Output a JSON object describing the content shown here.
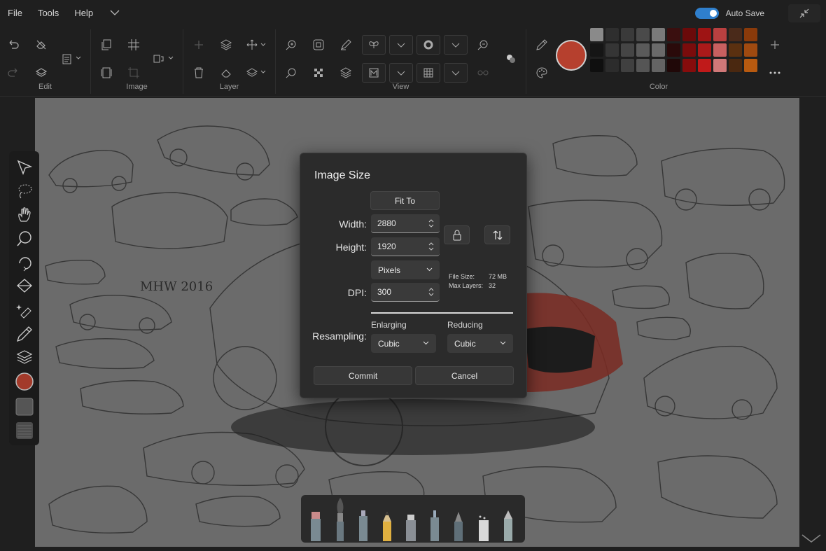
{
  "menu": {
    "items": [
      "File",
      "Tools",
      "Help"
    ]
  },
  "autosave": {
    "label": "Auto Save",
    "on": true
  },
  "ribbon": {
    "groups": {
      "edit": "Edit",
      "image": "Image",
      "layer": "Layer",
      "view": "View",
      "color": "Color"
    },
    "current_color": "#b6402e",
    "swatches": [
      "#8a8a8a",
      "#2e2e2e",
      "#3a3a3a",
      "#4a4a4a",
      "#7a7a7a",
      "#3a0f0f",
      "#6a0a0a",
      "#9e1414",
      "#b94040",
      "#4a2a1a",
      "#8a3a0a",
      "#151515",
      "#353535",
      "#454545",
      "#5a5a5a",
      "#6a6a6a",
      "#2a0a0a",
      "#7a0c0c",
      "#aa1a1a",
      "#c86060",
      "#5a3010",
      "#a04a10",
      "#0f0f0f",
      "#2c2c2c",
      "#404040",
      "#555555",
      "#646464",
      "#200808",
      "#860c0c",
      "#c01a1a",
      "#d07878",
      "#4a2810",
      "#b85a10"
    ]
  },
  "dialog": {
    "title": "Image Size",
    "fit_to": "Fit To",
    "width_label": "Width:",
    "width_value": "2880",
    "height_label": "Height:",
    "height_value": "1920",
    "units": "Pixels",
    "dpi_label": "DPI:",
    "dpi_value": "300",
    "file_size_label": "File Size:",
    "file_size_value": "72 MB",
    "max_layers_label": "Max Layers:",
    "max_layers_value": "32",
    "resampling_label": "Resampling:",
    "enlarging_label": "Enlarging",
    "enlarging_value": "Cubic",
    "reducing_label": "Reducing",
    "reducing_value": "Cubic",
    "commit": "Commit",
    "cancel": "Cancel"
  },
  "canvas": {
    "signature": "MHW 2016"
  }
}
